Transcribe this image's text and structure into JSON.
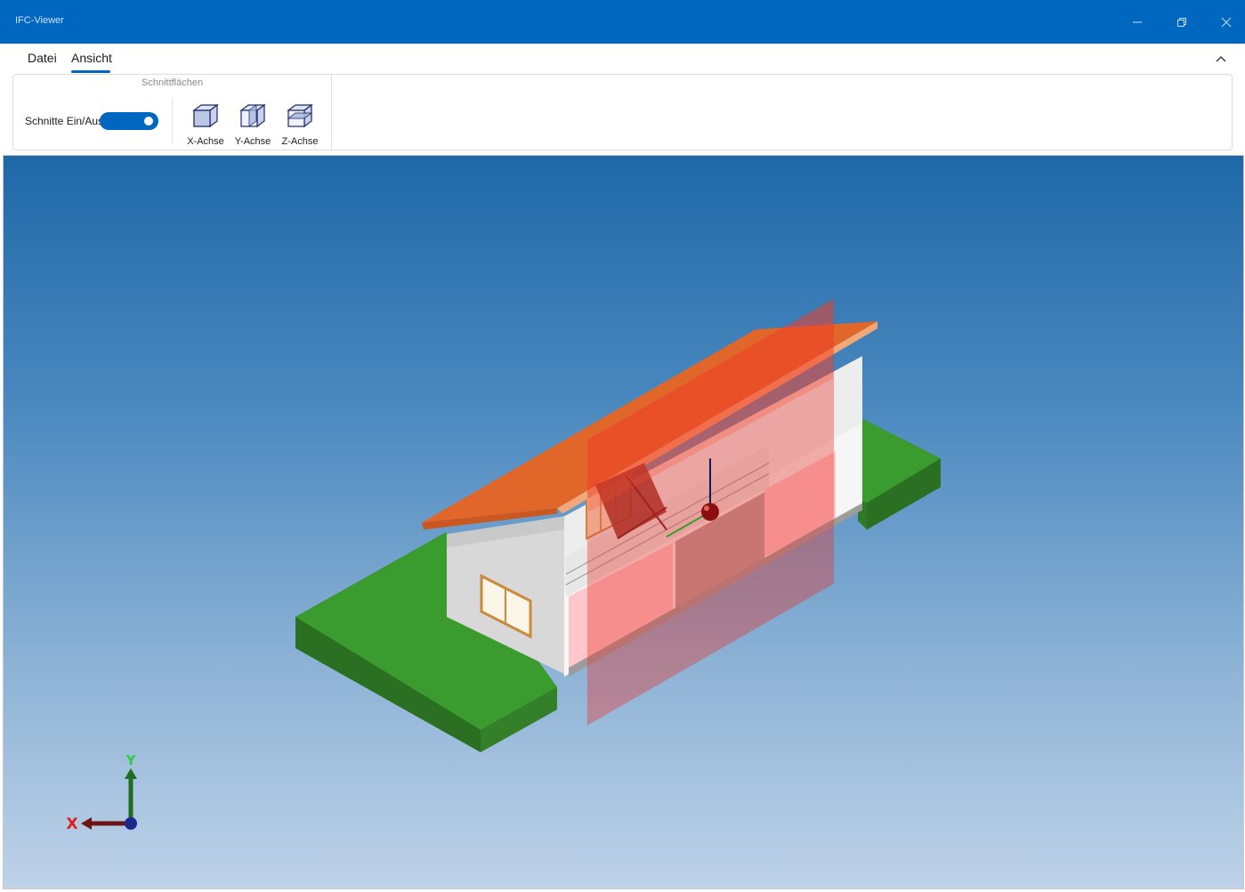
{
  "window": {
    "title": "IFC-Viewer"
  },
  "menu": {
    "tabs": [
      {
        "label": "Datei"
      },
      {
        "label": "Ansicht"
      }
    ],
    "active_tab": "Ansicht"
  },
  "ribbon": {
    "group_label": "Schnittflächen",
    "toggle": {
      "label": "Schnitte Ein/Aus",
      "state": "on"
    },
    "buttons": [
      {
        "label": "X-Achse"
      },
      {
        "label": "Y-Achse"
      },
      {
        "label": "Z-Achse"
      }
    ]
  },
  "viewport": {
    "axis_triad": {
      "x_label": "X",
      "y_label": "Y"
    }
  },
  "colors": {
    "accent": "#0067c0",
    "section_plane": "#e8332a",
    "roof": "#e0662a",
    "ground": "#3a9b2e"
  }
}
